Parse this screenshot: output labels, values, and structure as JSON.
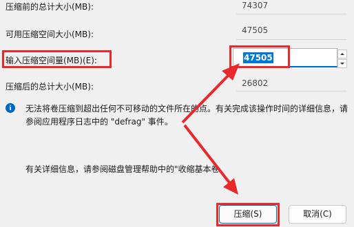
{
  "fields": {
    "total_before": {
      "label": "压缩前的总计大小(MB):",
      "value": "74307"
    },
    "available": {
      "label": "可用压缩空间大小(MB):",
      "value": "47505"
    },
    "input_amount": {
      "label": "输入压缩空间量(MB)(E):",
      "value": "47505"
    },
    "total_after": {
      "label": "压缩后的总计大小(MB):",
      "value": "26802"
    }
  },
  "info": {
    "icon": "info-icon",
    "line1": "无法将卷压缩到超出任何不可移动的文件所在的点。有关完成该操作时间的详细信息，请",
    "line2": "参阅应用程序日志中的 \"defrag\" 事件。"
  },
  "help_text": "有关详细信息，请参阅磁盘管理帮助中的\"收缩基本卷",
  "buttons": {
    "shrink": "压缩(S)",
    "cancel": "取消(C)"
  },
  "annotation": {
    "color": "#e8282b"
  }
}
